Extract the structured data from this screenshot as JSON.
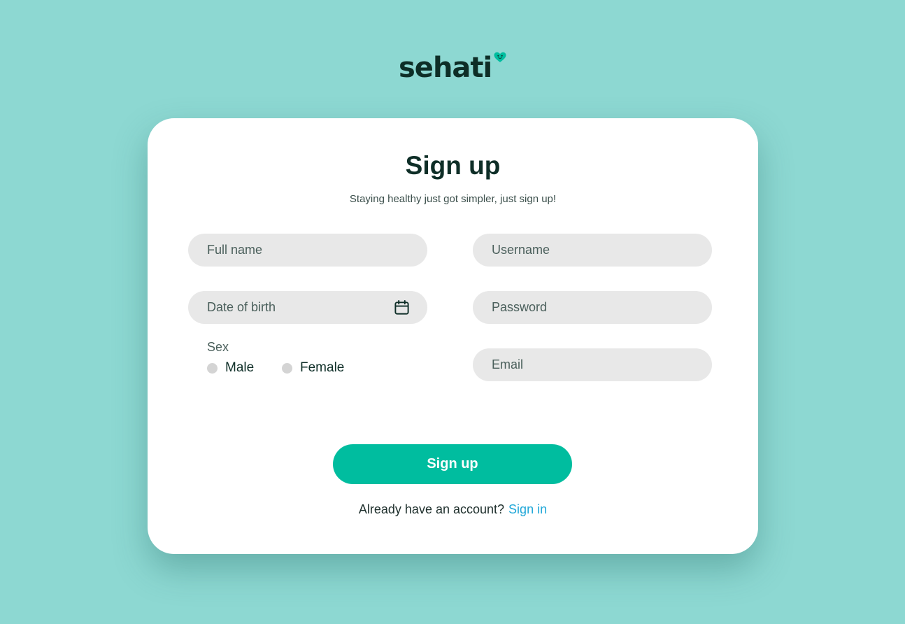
{
  "brand": {
    "name": "sehati",
    "text_color": "#0e2e27",
    "heart_color": "#00bd9f"
  },
  "form": {
    "title": "Sign up",
    "subtitle": "Staying healthy just got simpler, just sign up!",
    "full_name_placeholder": "Full name",
    "username_placeholder": "Username",
    "dob_placeholder": "Date of birth",
    "password_placeholder": "Password",
    "email_placeholder": "Email",
    "sex_label": "Sex",
    "sex_options": [
      "Male",
      "Female"
    ],
    "submit_label": "Sign up",
    "account_prompt": "Already have an account?",
    "signin_label": "Sign in"
  },
  "colors": {
    "background": "#8dd8d2",
    "card": "#ffffff",
    "input_fill": "#e8e8e8",
    "accent": "#00bd9f",
    "link": "#1fa7d8"
  }
}
